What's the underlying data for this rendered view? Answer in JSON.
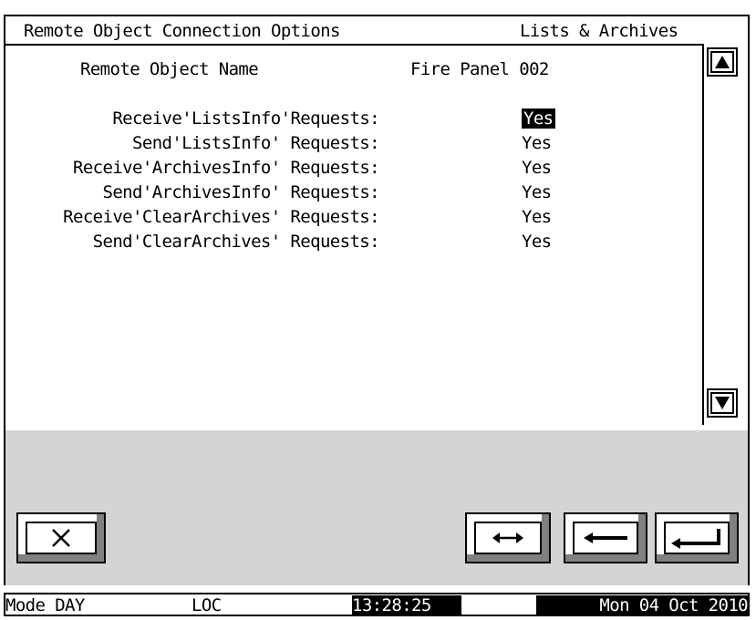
{
  "header": {
    "title": "Remote Object Connection Options",
    "section": "Lists & Archives"
  },
  "object": {
    "name_label": "Remote Object Name",
    "name_value": "Fire Panel 002"
  },
  "options": [
    {
      "label": "Receive'ListsInfo'Requests:",
      "value": "Yes",
      "selected": true
    },
    {
      "label": "Send'ListsInfo' Requests:",
      "value": "Yes",
      "selected": false
    },
    {
      "label": "Receive'ArchivesInfo' Requests:",
      "value": "Yes",
      "selected": false
    },
    {
      "label": "Send'ArchivesInfo' Requests:",
      "value": "Yes",
      "selected": false
    },
    {
      "label": "Receive'ClearArchives' Requests:",
      "value": "Yes",
      "selected": false
    },
    {
      "label": "Send'ClearArchives' Requests:",
      "value": "Yes",
      "selected": false
    }
  ],
  "toolbar": {
    "close_icon": "close-icon",
    "toggle_icon": "double-arrow-icon",
    "back_icon": "left-arrow-icon",
    "enter_icon": "enter-icon"
  },
  "status": {
    "mode": "Mode DAY",
    "loc": "LOC",
    "time": "13:28:25",
    "date": "Mon 04 Oct 2010"
  }
}
